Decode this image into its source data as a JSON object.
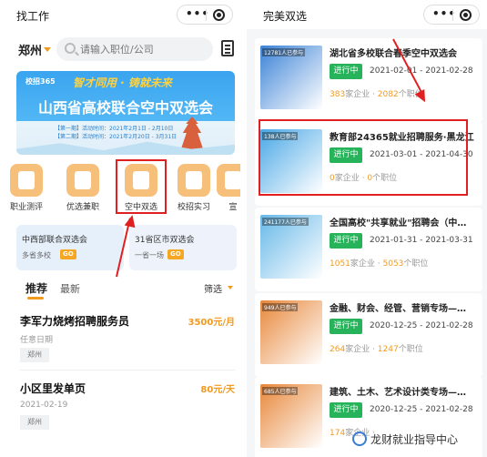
{
  "left": {
    "title": "找工作",
    "city": "郑州",
    "search_placeholder": "请输入职位/公司",
    "banner": {
      "logo": "校招365",
      "slogan": "智才同用 · 铸就未来",
      "title": "山西省高校联合空中双选会",
      "sub1": "【第一期】活动时间：2021年2月1日 - 2月10日",
      "sub2": "【第二期】活动时间：2021年2月20日 - 3月31日"
    },
    "grid": [
      {
        "label": "职业测评"
      },
      {
        "label": "优选兼职"
      },
      {
        "label": "空中双选"
      },
      {
        "label": "校招实习"
      },
      {
        "label": "宣"
      }
    ],
    "promos": [
      {
        "title": "中西部联合双选会",
        "sub": "多省多校",
        "go": "GO"
      },
      {
        "title": "31省区市双选会",
        "sub": "一省一场",
        "go": "GO"
      }
    ],
    "tabs": {
      "recommend": "推荐",
      "latest": "最新",
      "filter": "筛选"
    },
    "jobs": [
      {
        "title": "李军力烧烤招聘服务员",
        "salary": "3500元/月",
        "date": "任意日期",
        "tag": "郑州"
      },
      {
        "title": "小区里发单页",
        "salary": "80元/天",
        "date": "2021-02-19",
        "tag": "郑州"
      }
    ]
  },
  "right": {
    "title": "完美双选",
    "fairs": [
      {
        "badge": "12781人已参与",
        "title": "湖北省多校联合春季空中双选会",
        "status": "进行中",
        "dates": "2021-02-01 - 2021-02-28",
        "companies": "383",
        "companies_label": "家企业 · ",
        "positions": "2082",
        "positions_label": "个职位",
        "color": "#3b82d6"
      },
      {
        "badge": "138人已参与",
        "title": "教育部24365就业招聘服务·黑龙江",
        "status": "进行中",
        "dates": "2021-03-01 - 2021-04-30",
        "companies": "0",
        "companies_label": "家企业 · ",
        "positions": "0",
        "positions_label": "个职位",
        "color": "#49a7e6"
      },
      {
        "badge": "241177人已参与",
        "title": "全国高校\"共享就业\"招聘会（中…",
        "status": "进行中",
        "dates": "2021-01-31 - 2021-03-31",
        "companies": "1051",
        "companies_label": "家企业 · ",
        "positions": "5053",
        "positions_label": "个职位",
        "color": "#66b8e8"
      },
      {
        "badge": "949人已参与",
        "title": "金融、财会、经管、营销专场—…",
        "status": "进行中",
        "dates": "2020-12-25 - 2021-02-28",
        "companies": "264",
        "companies_label": "家企业 · ",
        "positions": "1247",
        "positions_label": "个职位",
        "color": "#e8873a"
      },
      {
        "badge": "685人已参与",
        "title": "建筑、土木、艺术设计类专场—…",
        "status": "进行中",
        "dates": "2020-12-25 - 2021-02-28",
        "companies": "174",
        "companies_label": "家企业 · ",
        "positions": "",
        "positions_label": "",
        "color": "#e8873a"
      }
    ]
  },
  "watermark": "龙财就业指导中心",
  "colors": {
    "accent": "#f29a1e",
    "status": "#26b35a",
    "highlight": "#e02020"
  }
}
